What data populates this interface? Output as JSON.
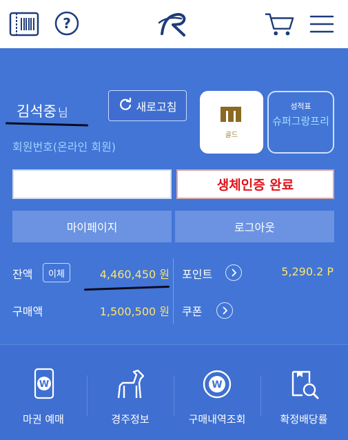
{
  "header": {
    "ticket_icon": "ticket-barcode-icon",
    "help_icon": "help-question-icon",
    "logo": "r-logo",
    "cart_icon": "cart-icon",
    "menu_icon": "hamburger-menu-icon"
  },
  "user": {
    "name": "김석중",
    "suffix": "님",
    "member_label": "회원번호(온라인 회원)",
    "refresh_label": "새로고침"
  },
  "grade": {
    "label": "골드"
  },
  "report": {
    "title": "성적표",
    "value": "슈퍼그랑프리"
  },
  "auth": {
    "label": "생체인증 완료"
  },
  "buttons": {
    "mypage": "마이페이지",
    "logout": "로그아웃"
  },
  "balance": {
    "label": "잔액",
    "transfer": "이체",
    "amount": "4,460,450 원",
    "point_label": "포인트",
    "point_value": "5,290.2 P",
    "purchase_label": "구매액",
    "purchase_amount": "1,500,500 원",
    "coupon_label": "쿠폰"
  },
  "bottom_nav": [
    {
      "label": "마권 예매",
      "icon": "phone-w-icon"
    },
    {
      "label": "경주정보",
      "icon": "horse-icon"
    },
    {
      "label": "구매내역조회",
      "icon": "w-coin-icon"
    },
    {
      "label": "확정배당률",
      "icon": "magnify-doc-icon"
    }
  ],
  "colors": {
    "panel": "#4275d5",
    "accent_yellow": "#ffe36b",
    "auth_red": "#e0131a"
  }
}
